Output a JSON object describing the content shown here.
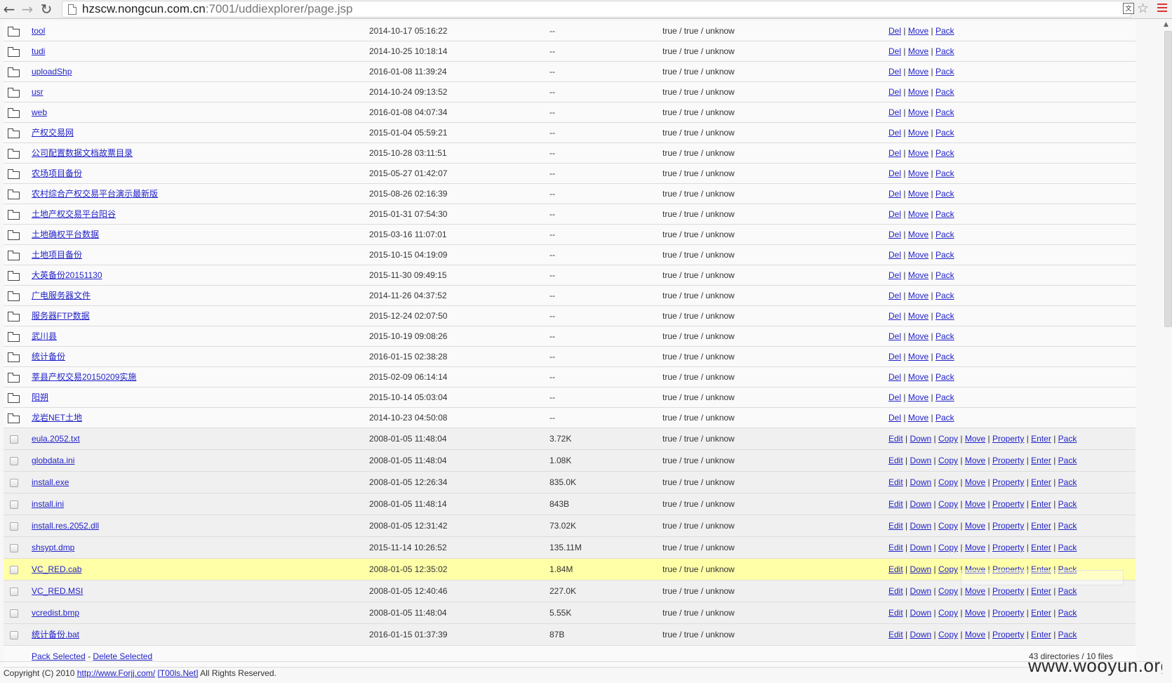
{
  "browser": {
    "url_host": "hzscw.nongcun.com.cn",
    "url_rest": ":7001/uddiexplorer/page.jsp",
    "translate_glyph": "文"
  },
  "actions": {
    "del": "Del",
    "move": "Move",
    "pack": "Pack",
    "edit": "Edit",
    "down": "Down",
    "copy": "Copy",
    "property": "Property",
    "enter": "Enter",
    "sep": "|"
  },
  "directories": [
    {
      "name": "tool",
      "time": "2014-10-17 05:16:22",
      "size": "--",
      "perm": "true / true / unknow"
    },
    {
      "name": "tudi",
      "time": "2014-10-25 10:18:14",
      "size": "--",
      "perm": "true / true / unknow"
    },
    {
      "name": "uploadShp",
      "time": "2016-01-08 11:39:24",
      "size": "--",
      "perm": "true / true / unknow"
    },
    {
      "name": "usr",
      "time": "2014-10-24 09:13:52",
      "size": "--",
      "perm": "true / true / unknow"
    },
    {
      "name": "web",
      "time": "2016-01-08 04:07:34",
      "size": "--",
      "perm": "true / true / unknow"
    },
    {
      "name": "产权交易网",
      "time": "2015-01-04 05:59:21",
      "size": "--",
      "perm": "true / true / unknow"
    },
    {
      "name": "公司配置数据文档故票目录",
      "time": "2015-10-28 03:11:51",
      "size": "--",
      "perm": "true / true / unknow"
    },
    {
      "name": "农场项目备份",
      "time": "2015-05-27 01:42:07",
      "size": "--",
      "perm": "true / true / unknow"
    },
    {
      "name": "农村综合产权交易平台演示最新版",
      "time": "2015-08-26 02:16:39",
      "size": "--",
      "perm": "true / true / unknow"
    },
    {
      "name": "土地产权交易平台阳谷",
      "time": "2015-01-31 07:54:30",
      "size": "--",
      "perm": "true / true / unknow"
    },
    {
      "name": "土地确权平台数据",
      "time": "2015-03-16 11:07:01",
      "size": "--",
      "perm": "true / true / unknow"
    },
    {
      "name": "土地项目备份",
      "time": "2015-10-15 04:19:09",
      "size": "--",
      "perm": "true / true / unknow"
    },
    {
      "name": "大英备份20151130",
      "time": "2015-11-30 09:49:15",
      "size": "--",
      "perm": "true / true / unknow"
    },
    {
      "name": "广电服务器文件",
      "time": "2014-11-26 04:37:52",
      "size": "--",
      "perm": "true / true / unknow"
    },
    {
      "name": "服务器FTP数据",
      "time": "2015-12-24 02:07:50",
      "size": "--",
      "perm": "true / true / unknow"
    },
    {
      "name": "武川县",
      "time": "2015-10-19 09:08:26",
      "size": "--",
      "perm": "true / true / unknow"
    },
    {
      "name": "统计备份",
      "time": "2016-01-15 02:38:28",
      "size": "--",
      "perm": "true / true / unknow"
    },
    {
      "name": "莘县产权交易20150209实施",
      "time": "2015-02-09 06:14:14",
      "size": "--",
      "perm": "true / true / unknow"
    },
    {
      "name": "阳朔",
      "time": "2015-10-14 05:03:04",
      "size": "--",
      "perm": "true / true / unknow"
    },
    {
      "name": "龙岩NET土地",
      "time": "2014-10-23 04:50:08",
      "size": "--",
      "perm": "true / true / unknow"
    }
  ],
  "files": [
    {
      "name": "eula.2052.txt",
      "time": "2008-01-05 11:48:04",
      "size": "3.72K",
      "perm": "true / true / unknow",
      "highlighted": false
    },
    {
      "name": "globdata.ini",
      "time": "2008-01-05 11:48:04",
      "size": "1.08K",
      "perm": "true / true / unknow",
      "highlighted": false
    },
    {
      "name": "install.exe",
      "time": "2008-01-05 12:26:34",
      "size": "835.0K",
      "perm": "true / true / unknow",
      "highlighted": false
    },
    {
      "name": "install.ini",
      "time": "2008-01-05 11:48:14",
      "size": "843B",
      "perm": "true / true / unknow",
      "highlighted": false
    },
    {
      "name": "install.res.2052.dll",
      "time": "2008-01-05 12:31:42",
      "size": "73.02K",
      "perm": "true / true / unknow",
      "highlighted": false
    },
    {
      "name": "shsypt.dmp",
      "time": "2015-11-14 10:26:52",
      "size": "135.11M",
      "perm": "true / true / unknow",
      "highlighted": false
    },
    {
      "name": "VC_RED.cab",
      "time": "2008-01-05 12:35:02",
      "size": "1.84M",
      "perm": "true / true / unknow",
      "highlighted": true
    },
    {
      "name": "VC_RED.MSI",
      "time": "2008-01-05 12:40:46",
      "size": "227.0K",
      "perm": "true / true / unknow",
      "highlighted": false
    },
    {
      "name": "vcredist.bmp",
      "time": "2008-01-05 11:48:04",
      "size": "5.55K",
      "perm": "true / true / unknow",
      "highlighted": false
    },
    {
      "name": "统计备份.bat",
      "time": "2016-01-15 01:37:39",
      "size": "87B",
      "perm": "true / true / unknow",
      "highlighted": false
    }
  ],
  "footer": {
    "pack_selected": "Pack Selected",
    "dash": "-",
    "delete_selected": "Delete Selected",
    "count": "43 directories / 10 files",
    "copyright_prefix": "Copyright (C) 2010",
    "site_link": "http://www.Forjj.com/",
    "tools_link": "[T00ls.Net]",
    "rights": "All Rights Reserved."
  },
  "watermark": "www.wooyun.org",
  "colors": {
    "highlight_row": "#ffffa8",
    "link": "#2323c8"
  }
}
